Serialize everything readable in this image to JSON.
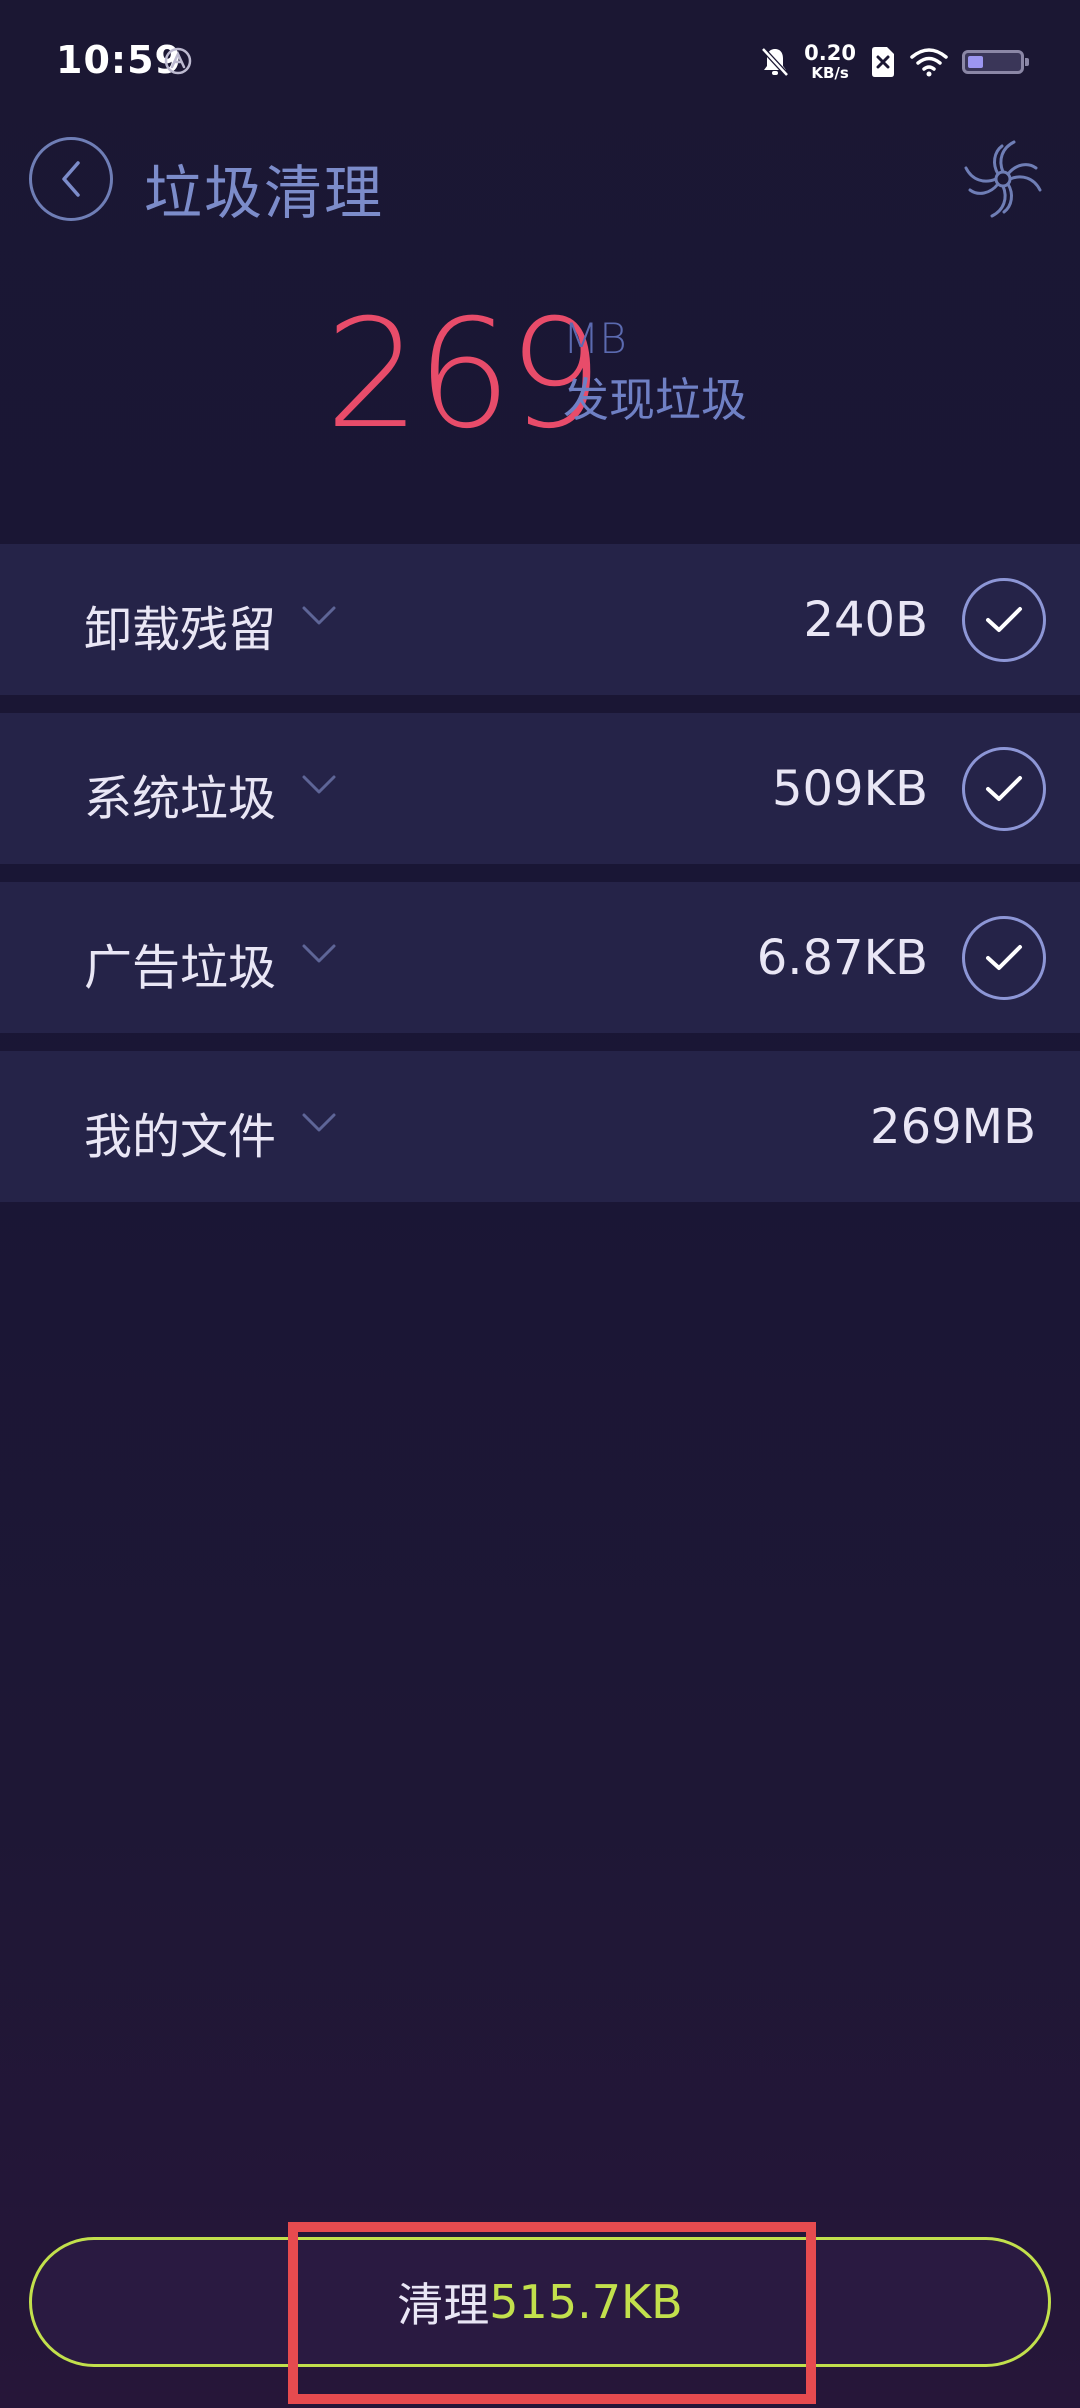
{
  "status_bar": {
    "time": "10:59",
    "net_speed_value": "0.20",
    "net_speed_unit": "KB/s",
    "battery_level": 0.3
  },
  "header": {
    "title": "垃圾清理"
  },
  "hero": {
    "size": "269",
    "unit": "MB",
    "label": "发现垃圾"
  },
  "categories": [
    {
      "name": "卸载残留",
      "size": "240B",
      "checked": true
    },
    {
      "name": "系统垃圾",
      "size": "509KB",
      "checked": true
    },
    {
      "name": "广告垃圾",
      "size": "6.87KB",
      "checked": true
    },
    {
      "name": "我的文件",
      "size": "269MB",
      "checked": false
    }
  ],
  "clean_button": {
    "label": "清理",
    "amount": "515.7KB"
  },
  "colors": {
    "accent_red": "#e84c6a",
    "accent_lime": "#c2e04c",
    "title_blue": "#7c8cca",
    "row_bg": "#252348",
    "annotation_box": "#e64b4f"
  }
}
